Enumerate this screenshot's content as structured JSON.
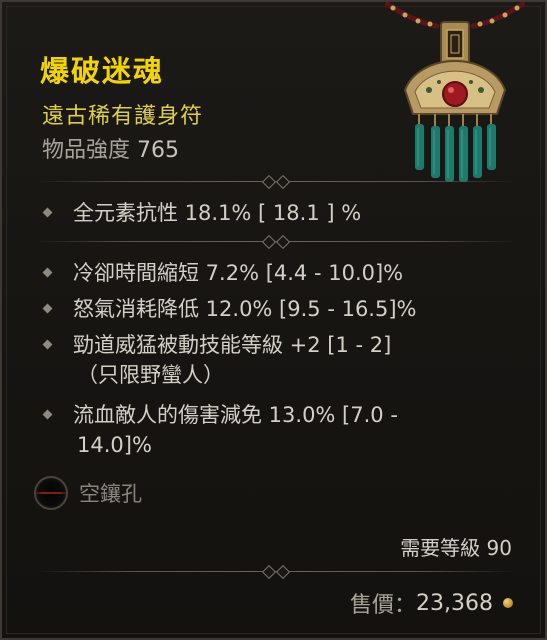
{
  "item": {
    "name": "爆破迷魂",
    "type": "遠古稀有護身符",
    "power_label": "物品強度",
    "power_value": "765"
  },
  "implicit": [
    {
      "text": "全元素抗性 18.1%  [ 18.1 ] %"
    }
  ],
  "affixes": [
    {
      "lines": [
        "冷卻時間縮短 7.2% [4.4 - 10.0]%"
      ]
    },
    {
      "lines": [
        "怒氣消耗降低 12.0% [9.5 - 16.5]%"
      ]
    },
    {
      "lines": [
        "勁道威猛被動技能等級 +2 [1 - 2]",
        "（只限野蠻人）"
      ]
    },
    {
      "lines": [
        "流血敵人的傷害減免 13.0% [7.0 -",
        "14.0]%"
      ]
    }
  ],
  "socket": {
    "label": "空鑲孔"
  },
  "requirement": {
    "text": "需要等級 90"
  },
  "sell": {
    "label": "售價：",
    "value": "23,368"
  },
  "colors": {
    "title": "#f2d500",
    "rarity": "#e0cf46",
    "text": "#d4d0c7",
    "muted": "#a9a49a"
  },
  "icons": {
    "item_image": "amulet-icon",
    "socket": "empty-socket-icon",
    "currency": "gold-coin-icon"
  }
}
